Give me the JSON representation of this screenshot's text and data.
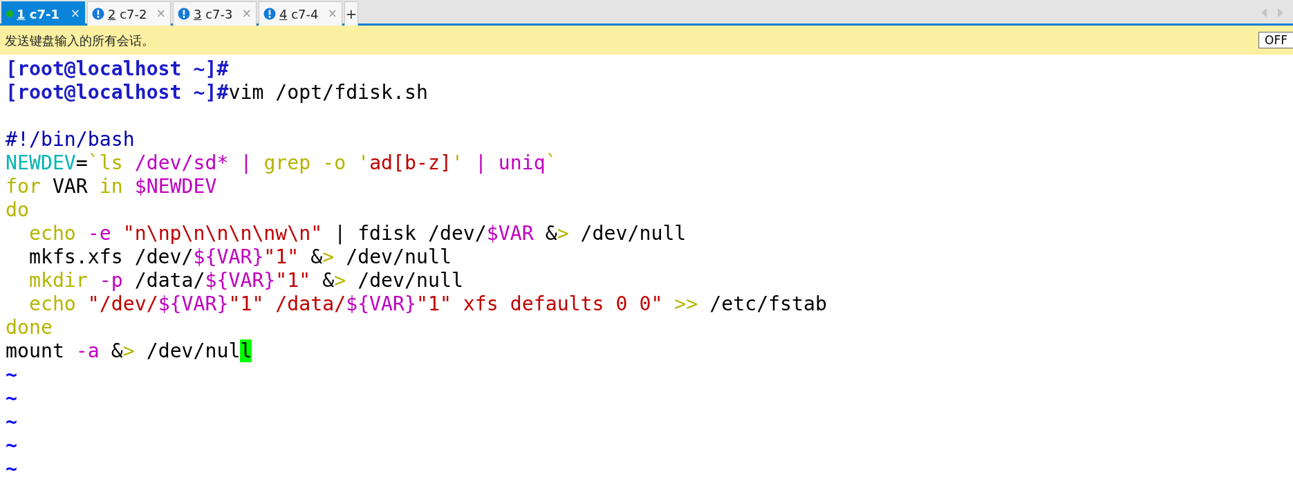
{
  "tabs": [
    {
      "number": "1",
      "label": "c7-1",
      "selected": true,
      "kind": "connected",
      "close": "×"
    },
    {
      "number": "2",
      "label": "c7-2",
      "selected": false,
      "kind": "alert",
      "close": "×"
    },
    {
      "number": "3",
      "label": "c7-3",
      "selected": false,
      "kind": "alert",
      "close": "×"
    },
    {
      "number": "4",
      "label": "c7-4",
      "selected": false,
      "kind": "alert",
      "close": "×"
    }
  ],
  "new_tab": "+",
  "banner": {
    "text": "发送键盘输入的所有会话。",
    "toggle": "OFF"
  },
  "terminal": {
    "lines": [
      [
        {
          "kind": "prompt",
          "text": "[root@localhost ~]#"
        }
      ],
      [
        {
          "kind": "prompt",
          "text": "[root@localhost ~]#"
        },
        {
          "kind": "plain",
          "text": "vim /opt/fdisk.sh"
        }
      ],
      {
        "kind": "blank"
      },
      [
        {
          "kind": "comment",
          "text": "#!/bin/bash"
        }
      ],
      [
        {
          "kind": "variable",
          "text": "NEWDEV"
        },
        {
          "kind": "plain",
          "text": "="
        },
        {
          "kind": "keyword",
          "text": "`ls"
        },
        {
          "kind": "special",
          "text": " /dev/sd* | "
        },
        {
          "kind": "keyword",
          "text": "grep -o '"
        },
        {
          "kind": "string",
          "text": "ad[b-z]"
        },
        {
          "kind": "keyword",
          "text": "'"
        },
        {
          "kind": "special",
          "text": " | uniq"
        },
        {
          "kind": "keyword",
          "text": "`"
        }
      ],
      [
        {
          "kind": "keyword",
          "text": "for"
        },
        {
          "kind": "plain",
          "text": " VAR "
        },
        {
          "kind": "keyword",
          "text": "in"
        },
        {
          "kind": "special",
          "text": " $NEWDEV"
        }
      ],
      [
        {
          "kind": "keyword",
          "text": "do"
        }
      ],
      [
        {
          "kind": "keyword",
          "text": "  echo"
        },
        {
          "kind": "special",
          "text": " -e "
        },
        {
          "kind": "string",
          "text": "\"n\\np\\n\\n\\n\\nw\\n\""
        },
        {
          "kind": "plain",
          "text": " | fdisk /dev/"
        },
        {
          "kind": "special",
          "text": "$VAR"
        },
        {
          "kind": "plain",
          "text": " &"
        },
        {
          "kind": "keyword",
          "text": ">"
        },
        {
          "kind": "plain",
          "text": " /dev/null"
        }
      ],
      [
        {
          "kind": "plain",
          "text": "  mkfs.xfs /dev/"
        },
        {
          "kind": "special",
          "text": "${VAR}"
        },
        {
          "kind": "string",
          "text": "\"1\""
        },
        {
          "kind": "plain",
          "text": " &"
        },
        {
          "kind": "keyword",
          "text": ">"
        },
        {
          "kind": "plain",
          "text": " /dev/null"
        }
      ],
      [
        {
          "kind": "keyword",
          "text": "  mkdir"
        },
        {
          "kind": "special",
          "text": " -p"
        },
        {
          "kind": "plain",
          "text": " /data/"
        },
        {
          "kind": "special",
          "text": "${VAR}"
        },
        {
          "kind": "string",
          "text": "\"1\""
        },
        {
          "kind": "plain",
          "text": " &"
        },
        {
          "kind": "keyword",
          "text": ">"
        },
        {
          "kind": "plain",
          "text": " /dev/null"
        }
      ],
      [
        {
          "kind": "keyword",
          "text": "  echo"
        },
        {
          "kind": "string",
          "text": " \"/dev/"
        },
        {
          "kind": "special",
          "text": "${VAR}"
        },
        {
          "kind": "string",
          "text": "\"1\" /data/"
        },
        {
          "kind": "special",
          "text": "${VAR}"
        },
        {
          "kind": "string",
          "text": "\"1\" xfs defaults 0 0\""
        },
        {
          "kind": "keyword",
          "text": " >>"
        },
        {
          "kind": "plain",
          "text": " /etc/fstab"
        }
      ],
      [
        {
          "kind": "keyword",
          "text": "done"
        }
      ],
      [
        {
          "kind": "plain",
          "text": "mount"
        },
        {
          "kind": "special",
          "text": " -a"
        },
        {
          "kind": "plain",
          "text": " &"
        },
        {
          "kind": "keyword",
          "text": ">"
        },
        {
          "kind": "plain",
          "text": " /dev/nul"
        },
        {
          "kind": "cursor",
          "text": "l"
        }
      ],
      [
        {
          "kind": "tilde",
          "text": "~"
        }
      ],
      [
        {
          "kind": "tilde",
          "text": "~"
        }
      ],
      [
        {
          "kind": "tilde",
          "text": "~"
        }
      ],
      [
        {
          "kind": "tilde",
          "text": "~"
        }
      ],
      [
        {
          "kind": "tilde",
          "text": "~"
        }
      ]
    ]
  }
}
